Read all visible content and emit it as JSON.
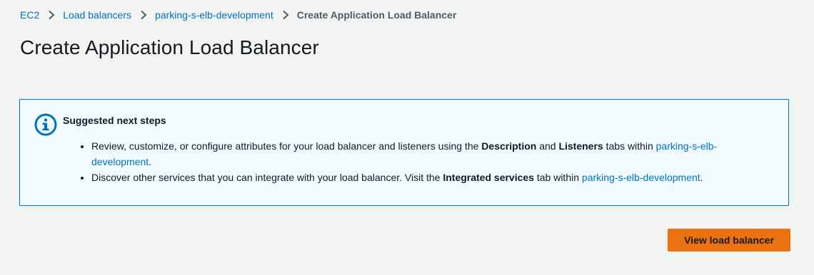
{
  "breadcrumb": {
    "items": [
      {
        "label": "EC2"
      },
      {
        "label": "Load balancers"
      },
      {
        "label": "parking-s-elb-development"
      }
    ],
    "current": "Create Application Load Balancer"
  },
  "page": {
    "title": "Create Application Load Balancer"
  },
  "alert": {
    "icon": "info-icon",
    "heading": "Suggested next steps",
    "item1": {
      "text_before": "Review, customize, or configure attributes for your load balancer and listeners using the ",
      "bold1": "Description",
      "text_mid": " and ",
      "bold2": "Listeners",
      "text_after": " tabs within ",
      "link": "parking-s-elb-development",
      "text_end": "."
    },
    "item2": {
      "text_before": "Discover other services that you can integrate with your load balancer. Visit the ",
      "bold1": "Integrated services",
      "text_after": " tab within ",
      "link": "parking-s-elb-development",
      "text_end": "."
    }
  },
  "actions": {
    "view_button": "View load balancer"
  },
  "colors": {
    "background": "#f2f3f3",
    "link": "#0073bb",
    "alert_background": "#f1faff",
    "alert_border": "#0073bb",
    "primary_button": "#ec7211"
  }
}
